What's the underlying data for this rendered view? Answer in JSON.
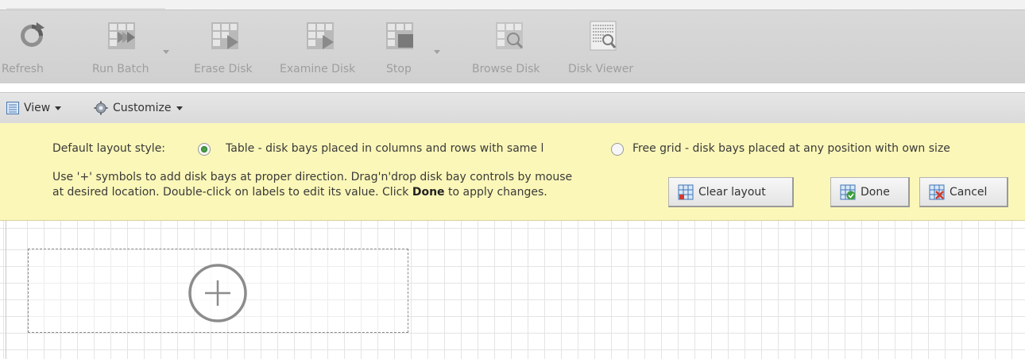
{
  "toolbar": {
    "buttons": [
      {
        "label": "Refresh",
        "icon": "refresh-icon"
      },
      {
        "label": "Run Batch",
        "icon": "run-batch-icon"
      },
      {
        "label": "Erase Disk",
        "icon": "erase-disk-icon"
      },
      {
        "label": "Examine Disk",
        "icon": "examine-disk-icon"
      },
      {
        "label": "Stop",
        "icon": "stop-icon"
      },
      {
        "label": "Browse Disk",
        "icon": "browse-disk-icon"
      },
      {
        "label": "Disk Viewer",
        "icon": "disk-viewer-icon"
      }
    ]
  },
  "viewbar": {
    "view_label": "View",
    "customize_label": "Customize"
  },
  "notice": {
    "layout_label": "Default layout style:",
    "option_table": "Table - disk bays placed in columns and rows with same l",
    "option_free": "Free grid - disk bays placed at any position with own size",
    "selected": "table",
    "help_line1": "Use '+' symbols to add disk bays at proper direction. Drag'n'drop disk bay controls by mouse",
    "help_line2_pre": "at desired location. Double-click on labels to edit its value. Click ",
    "help_line2_bold": "Done",
    "help_line2_post": " to apply changes.",
    "clear_label": "Clear layout",
    "done_label": "Done",
    "cancel_label": "Cancel"
  },
  "colors": {
    "notice_bg": "#fbf7b8",
    "toolbar_bg": "#d4d4d4",
    "radio_on": "#4aa14a"
  }
}
